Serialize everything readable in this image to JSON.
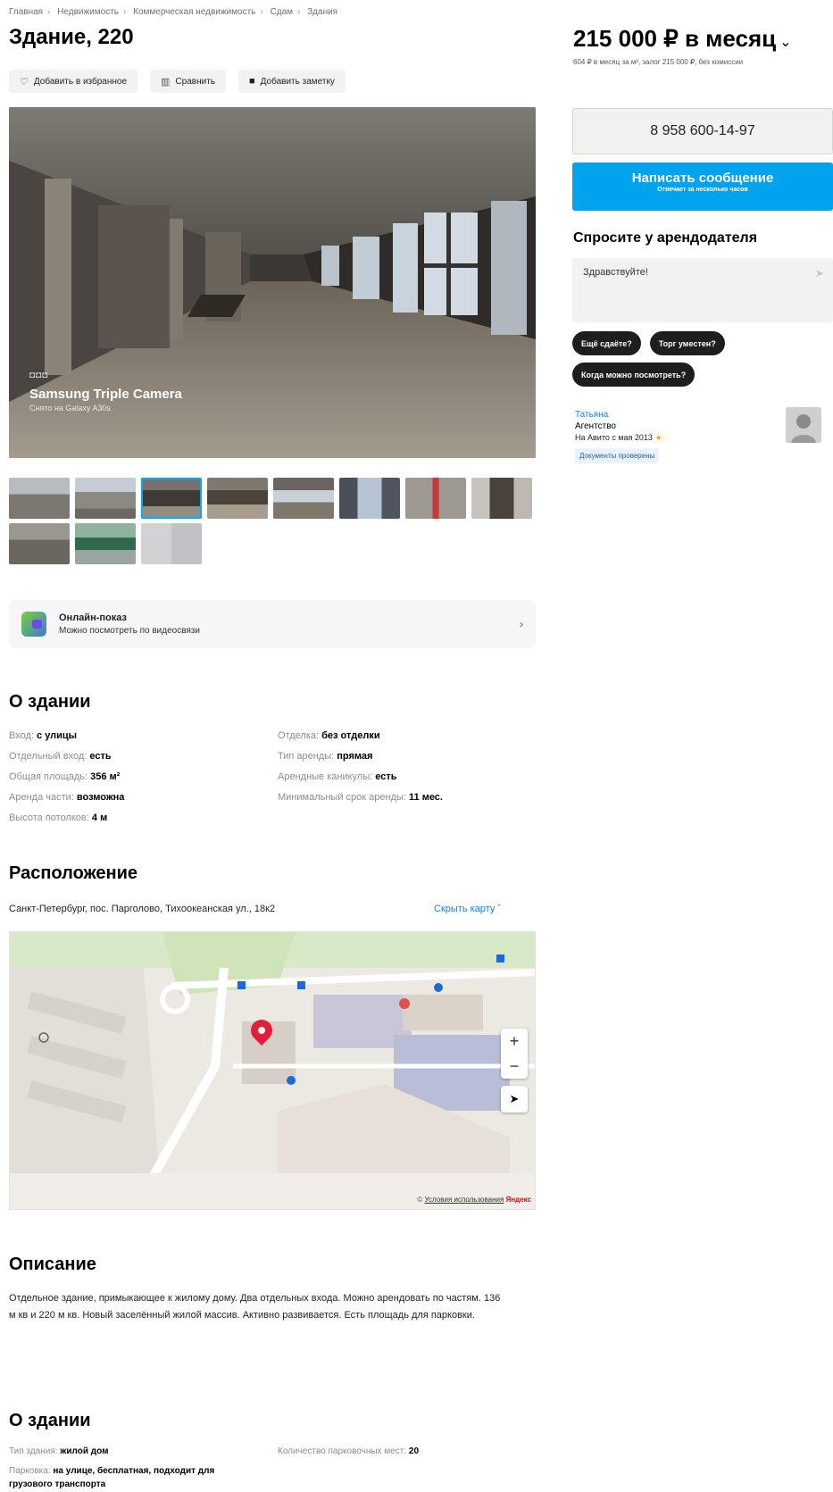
{
  "breadcrumbs": [
    "Главная",
    "Недвижимость",
    "Коммерческая недвижимость",
    "Сдам",
    "Здания"
  ],
  "title": "Здание, 220",
  "actions": {
    "favorite": "Добавить в избранное",
    "compare": "Сравнить",
    "note": "Добавить заметку"
  },
  "photo": {
    "camera_brand": "Samsung Triple Camera",
    "camera_model": "Снято на Galaxy A30s"
  },
  "online_show": {
    "title": "Онлайн-показ",
    "subtitle": "Можно посмотреть по видеосвязи"
  },
  "about1": {
    "heading": "О здании",
    "left": [
      {
        "k": "Вход:",
        "v": "с улицы"
      },
      {
        "k": "Отдельный вход:",
        "v": "есть"
      },
      {
        "k": "Общая площадь:",
        "v": "356 м²"
      },
      {
        "k": "Аренда части:",
        "v": "возможна"
      },
      {
        "k": "Высота потолков:",
        "v": "4 м"
      }
    ],
    "right": [
      {
        "k": "Отделка:",
        "v": "без отделки"
      },
      {
        "k": "Тип аренды:",
        "v": "прямая"
      },
      {
        "k": "Арендные каникулы:",
        "v": "есть"
      },
      {
        "k": "Минимальный срок аренды:",
        "v": "11 мес."
      }
    ]
  },
  "location": {
    "heading": "Расположение",
    "address": "Санкт-Петербург, пос. Парголово, Тихоокеанская ул., 18к2",
    "hide_map": "Скрыть карту",
    "map_footer_terms": "Условия использования",
    "map_footer_brand": "Яндекс"
  },
  "description": {
    "heading": "Описание",
    "text": "Отдельное здание, примыкающее к жилому дому. Два отдельных входа. Можно арендовать по частям. 136 м кв и 220 м кв. Новый заселённый жилой массив. Активно развивается. Есть площадь для парковки."
  },
  "about2": {
    "heading": "О здании",
    "left": [
      {
        "k": "Тип здания:",
        "v": "жилой дом"
      },
      {
        "k": "Парковка:",
        "v": "на улице, бесплатная, подходит для грузового транспорта"
      }
    ],
    "right": [
      {
        "k": "Количество парковочных мест:",
        "v": "20"
      }
    ]
  },
  "sidebar": {
    "price": "215 000 ₽ в месяц",
    "price_sub": "604 ₽ в месяц за м², залог 215 000 ₽, без комиссии",
    "phone": "8 958 600-14-97",
    "message_btn": "Написать сообщение",
    "message_sub": "Отвечает за несколько часов",
    "ask_heading": "Спросите у арендодателя",
    "ask_placeholder": "Здравствуйте!",
    "chips": [
      "Ещё сдаёте?",
      "Торг уместен?",
      "Когда можно посмотреть?"
    ],
    "seller_name": "Татьяна",
    "seller_type": "Агентство",
    "seller_since": "На Авито с мая 2013",
    "badge": "Документы проверены"
  },
  "colors": {
    "accent": "#02a3ee",
    "link": "#0a84ff",
    "chip_bg": "#1e1e1e"
  }
}
